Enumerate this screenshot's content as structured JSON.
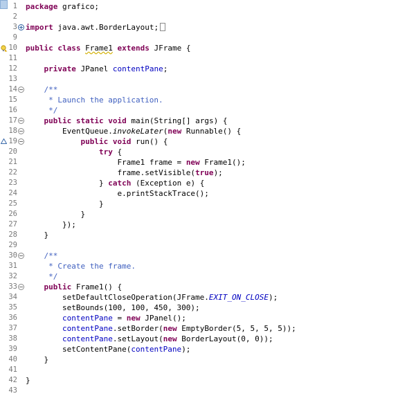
{
  "editor": {
    "lines": [
      {
        "num": "1",
        "tokens": [
          {
            "t": "package",
            "c": "kw"
          },
          {
            "t": " grafico;",
            "c": ""
          }
        ]
      },
      {
        "num": "2",
        "tokens": []
      },
      {
        "num": "3",
        "fold": "plus",
        "tokens": [
          {
            "t": "import",
            "c": "kw"
          },
          {
            "t": " java.awt.BorderLayout;",
            "c": ""
          }
        ],
        "collapsed": true
      },
      {
        "num": "9",
        "tokens": []
      },
      {
        "num": "10",
        "tokens": [
          {
            "t": "public",
            "c": "kw"
          },
          {
            "t": " ",
            "c": ""
          },
          {
            "t": "class",
            "c": "kw"
          },
          {
            "t": " ",
            "c": ""
          },
          {
            "t": "Frame1",
            "c": "warn"
          },
          {
            "t": " ",
            "c": ""
          },
          {
            "t": "extends",
            "c": "kw"
          },
          {
            "t": " JFrame {",
            "c": ""
          }
        ]
      },
      {
        "num": "11",
        "tokens": []
      },
      {
        "num": "12",
        "tokens": [
          {
            "t": "    ",
            "c": ""
          },
          {
            "t": "private",
            "c": "kw"
          },
          {
            "t": " JPanel ",
            "c": ""
          },
          {
            "t": "contentPane",
            "c": "fld"
          },
          {
            "t": ";",
            "c": ""
          }
        ]
      },
      {
        "num": "13",
        "tokens": []
      },
      {
        "num": "14",
        "fold": "minus",
        "tokens": [
          {
            "t": "    /**",
            "c": "cmt"
          }
        ]
      },
      {
        "num": "15",
        "tokens": [
          {
            "t": "     * Launch the application.",
            "c": "cmt"
          }
        ]
      },
      {
        "num": "16",
        "tokens": [
          {
            "t": "     */",
            "c": "cmt"
          }
        ]
      },
      {
        "num": "17",
        "fold": "minus",
        "tokens": [
          {
            "t": "    ",
            "c": ""
          },
          {
            "t": "public",
            "c": "kw"
          },
          {
            "t": " ",
            "c": ""
          },
          {
            "t": "static",
            "c": "kw"
          },
          {
            "t": " ",
            "c": ""
          },
          {
            "t": "void",
            "c": "kw"
          },
          {
            "t": " main(String[] ",
            "c": ""
          },
          {
            "t": "args",
            "c": "var"
          },
          {
            "t": ") {",
            "c": ""
          }
        ]
      },
      {
        "num": "18",
        "fold": "minus",
        "tokens": [
          {
            "t": "        EventQueue.",
            "c": ""
          },
          {
            "t": "invokeLater",
            "c": "it"
          },
          {
            "t": "(",
            "c": ""
          },
          {
            "t": "new",
            "c": "kw"
          },
          {
            "t": " Runnable() {",
            "c": ""
          }
        ]
      },
      {
        "num": "19",
        "fold": "minus",
        "tokens": [
          {
            "t": "            ",
            "c": ""
          },
          {
            "t": "public",
            "c": "kw"
          },
          {
            "t": " ",
            "c": ""
          },
          {
            "t": "void",
            "c": "kw"
          },
          {
            "t": " run() {",
            "c": ""
          }
        ]
      },
      {
        "num": "20",
        "tokens": [
          {
            "t": "                ",
            "c": ""
          },
          {
            "t": "try",
            "c": "kw"
          },
          {
            "t": " {",
            "c": ""
          }
        ]
      },
      {
        "num": "21",
        "tokens": [
          {
            "t": "                    Frame1 ",
            "c": ""
          },
          {
            "t": "frame",
            "c": "var"
          },
          {
            "t": " = ",
            "c": ""
          },
          {
            "t": "new",
            "c": "kw"
          },
          {
            "t": " Frame1();",
            "c": ""
          }
        ]
      },
      {
        "num": "22",
        "tokens": [
          {
            "t": "                    ",
            "c": ""
          },
          {
            "t": "frame",
            "c": "var"
          },
          {
            "t": ".setVisible(",
            "c": ""
          },
          {
            "t": "true",
            "c": "kw"
          },
          {
            "t": ");",
            "c": ""
          }
        ]
      },
      {
        "num": "23",
        "tokens": [
          {
            "t": "                } ",
            "c": ""
          },
          {
            "t": "catch",
            "c": "kw"
          },
          {
            "t": " (Exception ",
            "c": ""
          },
          {
            "t": "e",
            "c": "var"
          },
          {
            "t": ") {",
            "c": ""
          }
        ]
      },
      {
        "num": "24",
        "tokens": [
          {
            "t": "                    ",
            "c": ""
          },
          {
            "t": "e",
            "c": "var"
          },
          {
            "t": ".printStackTrace();",
            "c": ""
          }
        ]
      },
      {
        "num": "25",
        "tokens": [
          {
            "t": "                }",
            "c": ""
          }
        ]
      },
      {
        "num": "26",
        "tokens": [
          {
            "t": "            }",
            "c": ""
          }
        ]
      },
      {
        "num": "27",
        "tokens": [
          {
            "t": "        });",
            "c": ""
          }
        ]
      },
      {
        "num": "28",
        "tokens": [
          {
            "t": "    }",
            "c": ""
          }
        ]
      },
      {
        "num": "29",
        "tokens": []
      },
      {
        "num": "30",
        "fold": "minus",
        "tokens": [
          {
            "t": "    /**",
            "c": "cmt"
          }
        ]
      },
      {
        "num": "31",
        "tokens": [
          {
            "t": "     * Create the frame.",
            "c": "cmt"
          }
        ]
      },
      {
        "num": "32",
        "tokens": [
          {
            "t": "     */",
            "c": "cmt"
          }
        ]
      },
      {
        "num": "33",
        "fold": "minus",
        "tokens": [
          {
            "t": "    ",
            "c": ""
          },
          {
            "t": "public",
            "c": "kw"
          },
          {
            "t": " Frame1() {",
            "c": ""
          }
        ]
      },
      {
        "num": "34",
        "tokens": [
          {
            "t": "        setDefaultCloseOperation(JFrame.",
            "c": ""
          },
          {
            "t": "EXIT_ON_CLOSE",
            "c": "sfi"
          },
          {
            "t": ");",
            "c": ""
          }
        ]
      },
      {
        "num": "35",
        "tokens": [
          {
            "t": "        setBounds(100, 100, 450, 300);",
            "c": ""
          }
        ]
      },
      {
        "num": "36",
        "tokens": [
          {
            "t": "        ",
            "c": ""
          },
          {
            "t": "contentPane",
            "c": "fld"
          },
          {
            "t": " = ",
            "c": ""
          },
          {
            "t": "new",
            "c": "kw"
          },
          {
            "t": " JPanel();",
            "c": ""
          }
        ]
      },
      {
        "num": "37",
        "tokens": [
          {
            "t": "        ",
            "c": ""
          },
          {
            "t": "contentPane",
            "c": "fld"
          },
          {
            "t": ".setBorder(",
            "c": ""
          },
          {
            "t": "new",
            "c": "kw"
          },
          {
            "t": " EmptyBorder(5, 5, 5, 5));",
            "c": ""
          }
        ]
      },
      {
        "num": "38",
        "tokens": [
          {
            "t": "        ",
            "c": ""
          },
          {
            "t": "contentPane",
            "c": "fld"
          },
          {
            "t": ".setLayout(",
            "c": ""
          },
          {
            "t": "new",
            "c": "kw"
          },
          {
            "t": " BorderLayout(0, 0));",
            "c": ""
          }
        ]
      },
      {
        "num": "39",
        "tokens": [
          {
            "t": "        setContentPane(",
            "c": ""
          },
          {
            "t": "contentPane",
            "c": "fld"
          },
          {
            "t": ");",
            "c": ""
          }
        ]
      },
      {
        "num": "40",
        "tokens": [
          {
            "t": "    }",
            "c": ""
          }
        ]
      },
      {
        "num": "41",
        "tokens": []
      },
      {
        "num": "42",
        "tokens": [
          {
            "t": "}",
            "c": ""
          }
        ]
      },
      {
        "num": "43",
        "tokens": []
      }
    ]
  },
  "markers": {
    "line10": "warning-lightbulb",
    "line19": "override-triangle"
  },
  "colors": {
    "keyword": "#7f0055",
    "field": "#0000c0",
    "comment": "#3f5fbf",
    "line_number": "#787878",
    "warning": "#d2b000"
  }
}
